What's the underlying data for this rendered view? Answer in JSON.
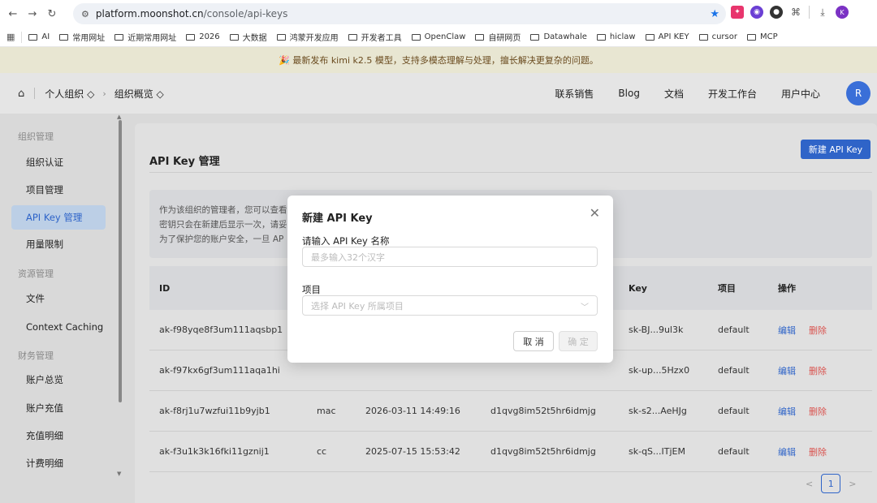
{
  "browser": {
    "url_host": "platform.moonshot.cn",
    "url_path": "/console/api-keys",
    "bookmarks": [
      "AI",
      "常用网址",
      "近期常用网址",
      "2026",
      "大数据",
      "鸿蒙开发应用",
      "开发者工具",
      "OpenClaw",
      "自研网页",
      "Datawhale",
      "hiclaw",
      "API KEY",
      "cursor",
      "MCP"
    ]
  },
  "announcement": "🎉 最新发布 kimi k2.5 模型，支持多模态理解与处理，擅长解决更复杂的问题。",
  "header": {
    "org_switch": "个人组织 ◇",
    "overview": "组织概览 ◇",
    "nav": [
      "联系销售",
      "Blog",
      "文档",
      "开发工作台",
      "用户中心"
    ]
  },
  "sidebar": {
    "group1": "组织管理",
    "items1": [
      "组织认证",
      "项目管理",
      "API Key 管理",
      "用量限制"
    ],
    "group2": "资源管理",
    "items2": [
      "文件",
      "Context Caching"
    ],
    "group3": "财务管理",
    "items3": [
      "账户总览",
      "账户充值",
      "充值明细",
      "计费明细"
    ]
  },
  "main": {
    "title": "API Key 管理",
    "new_button": "新建 API Key",
    "info_lines": [
      "作为该组织的管理者，您可以查看",
      "密钥只会在新建后显示一次，请妥",
      "为了保护您的账户安全，一旦 AP"
    ]
  },
  "table": {
    "headers": [
      "ID",
      "",
      "",
      "",
      "Key",
      "项目",
      "操作"
    ],
    "rows": [
      {
        "id": "ak-f98yqe8f3um111aqsbp1",
        "owner": "",
        "created": "",
        "project": "",
        "key": "sk-BJ...9ul3k",
        "scope": "default",
        "edit": "编辑",
        "del": "删除"
      },
      {
        "id": "ak-f97kx6gf3um111aqa1hi",
        "owner": "",
        "created": "",
        "project": "",
        "key": "sk-up...5Hzx0",
        "scope": "default",
        "edit": "编辑",
        "del": "删除"
      },
      {
        "id": "ak-f8rj1u7wzfui11b9yjb1",
        "owner": "mac",
        "created": "2026-03-11 14:49:16",
        "project": "d1qvg8im52t5hr6idmjg",
        "key": "sk-s2...AeHJg",
        "scope": "default",
        "edit": "编辑",
        "del": "删除"
      },
      {
        "id": "ak-f3u1k3k16fki11gznij1",
        "owner": "cc",
        "created": "2025-07-15 15:53:42",
        "project": "d1qvg8im52t5hr6idmjg",
        "key": "sk-qS...ITjEM",
        "scope": "default",
        "edit": "编辑",
        "del": "删除"
      }
    ]
  },
  "pager": {
    "current": "1",
    "prev": "<",
    "next": ">"
  },
  "modal": {
    "title": "新建 API Key",
    "name_label": "请输入 API Key 名称",
    "name_placeholder": "最多输入32个汉字",
    "project_label": "项目",
    "project_placeholder": "选择 API Key 所属项目",
    "cancel": "取 消",
    "ok": "确 定"
  },
  "avatar_initial": "R"
}
